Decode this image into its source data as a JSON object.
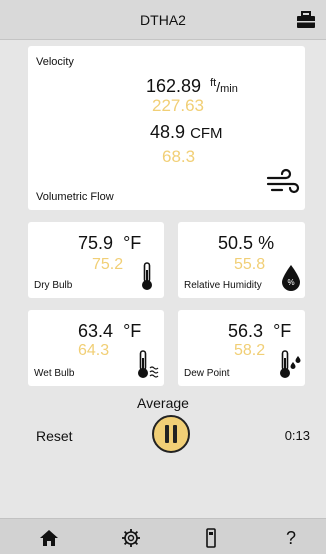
{
  "header": {
    "title": "DTHA2",
    "toolbox_icon": "toolbox-icon"
  },
  "velocity_card": {
    "label": "Velocity",
    "velocity_value": "162.89",
    "velocity_unit_num": "ft",
    "velocity_unit_den": "min",
    "velocity_secondary": "227.63",
    "flow_value": "48.9",
    "flow_unit": "CFM",
    "flow_secondary": "68.3",
    "flow_label": "Volumetric Flow",
    "icon": "wind-icon"
  },
  "dry_bulb": {
    "value": "75.9",
    "unit": "°F",
    "secondary": "75.2",
    "label": "Dry Bulb",
    "icon": "thermometer-icon"
  },
  "humidity": {
    "value": "50.5",
    "unit": "%",
    "secondary": "55.8",
    "label": "Relative Humidity",
    "icon": "humidity-drop-icon"
  },
  "wet_bulb": {
    "value": "63.4",
    "unit": "°F",
    "secondary": "64.3",
    "label": "Wet Bulb",
    "icon": "wet-bulb-thermometer-icon"
  },
  "dew_point": {
    "value": "56.3",
    "unit": "°F",
    "secondary": "58.2",
    "label": "Dew Point",
    "icon": "dew-point-thermometer-icon"
  },
  "controls": {
    "average_label": "Average",
    "reset_label": "Reset",
    "timer": "0:13",
    "pause_icon": "pause-icon"
  },
  "tabbar": {
    "items": [
      "home-icon",
      "settings-gear-icon",
      "meter-device-icon"
    ],
    "help_label": "?"
  },
  "colors": {
    "secondary_value": "#f1cf76",
    "background": "#e6e6e6",
    "card": "#ffffff"
  }
}
